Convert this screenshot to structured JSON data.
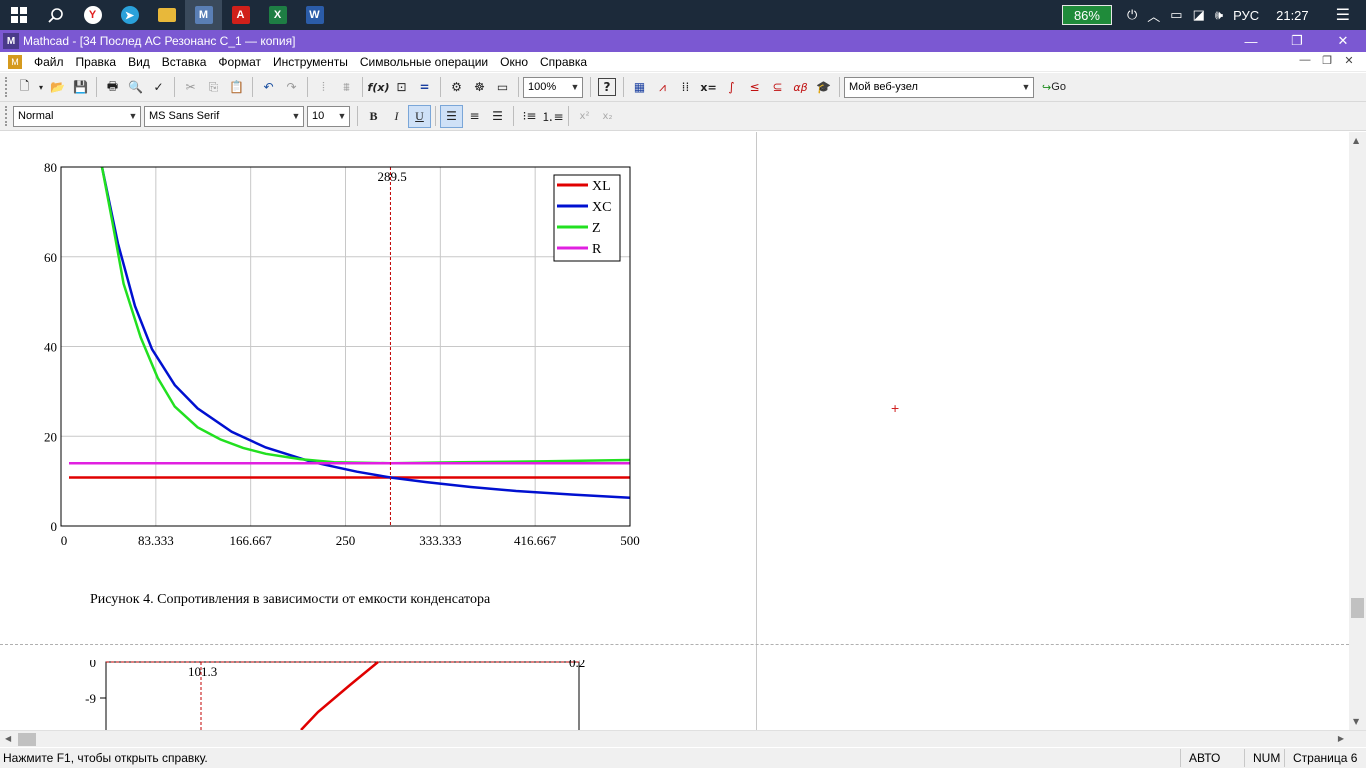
{
  "taskbar": {
    "battery": "86%",
    "lang": "РУС",
    "time": "21:27",
    "apps": [
      "start",
      "search",
      "yandex",
      "telegram",
      "explorer",
      "mathcad",
      "acrobat",
      "excel",
      "word"
    ]
  },
  "window": {
    "title": "Mathcad - [34 Послед АС Резонанс С_1 — копия]",
    "logo": "M"
  },
  "menu": {
    "items": [
      "Файл",
      "Правка",
      "Вид",
      "Вставка",
      "Формат",
      "Инструменты",
      "Символьные операции",
      "Окно",
      "Справка"
    ]
  },
  "toolbar": {
    "zoom": "100%",
    "web_node": "Мой веб-узел",
    "go_label": "Go",
    "style": "Normal",
    "font": "MS Sans Serif",
    "font_size": "10",
    "bold": "B",
    "italic": "I",
    "underline": "U"
  },
  "document": {
    "caption": "Рисунок 4.  Сопротивления в зависимости от емкости конденсатора",
    "cursor": "+"
  },
  "chart_data": [
    {
      "type": "line",
      "xlim": [
        0,
        500
      ],
      "ylim": [
        0,
        80
      ],
      "x_ticks": [
        "0",
        "83.333",
        "166.667",
        "250",
        "333.333",
        "416.667",
        "500"
      ],
      "y_ticks": [
        "0",
        "20",
        "40",
        "60",
        "80"
      ],
      "marker": {
        "x": 289.5,
        "label": "289.5"
      },
      "legend_position": "top-right",
      "grid": true,
      "series": [
        {
          "name": "XL",
          "color": "#e00000",
          "x": [
            7,
            500
          ],
          "y": [
            10.8,
            10.8
          ]
        },
        {
          "name": "XC",
          "color": "#0010d0",
          "x": [
            36,
            50,
            65,
            80,
            100,
            120,
            150,
            180,
            220,
            260,
            289.5,
            320,
            360,
            400,
            450,
            500
          ],
          "y": [
            80,
            63,
            49,
            39.4,
            31.4,
            26.2,
            21,
            17.5,
            14.3,
            12.1,
            10.8,
            9.8,
            8.7,
            7.8,
            7.0,
            6.3
          ]
        },
        {
          "name": "Z",
          "color": "#22e020",
          "x": [
            36,
            45,
            55,
            70,
            85,
            100,
            120,
            140,
            160,
            180,
            210,
            240,
            289.5,
            350,
            420,
            500
          ],
          "y": [
            80,
            68,
            54,
            42,
            33,
            26.6,
            22,
            19.3,
            17.4,
            16.1,
            14.9,
            14.2,
            14.0,
            14.2,
            14.4,
            14.7
          ]
        },
        {
          "name": "R",
          "color": "#e020e0",
          "x": [
            7,
            500
          ],
          "y": [
            14,
            14
          ]
        }
      ]
    },
    {
      "type": "line",
      "ylim": [
        -10,
        0
      ],
      "y_ticks": [
        "0",
        "-9"
      ],
      "marker": {
        "label": "101.3"
      },
      "top_right_label": "0.2",
      "series": [
        {
          "name": "",
          "color": "#e00000",
          "points_partial": true
        }
      ]
    }
  ],
  "status": {
    "help": "Нажмите F1, чтобы открыть справку.",
    "mode": "АВТО",
    "num": "NUM",
    "page": "Страница 6"
  }
}
